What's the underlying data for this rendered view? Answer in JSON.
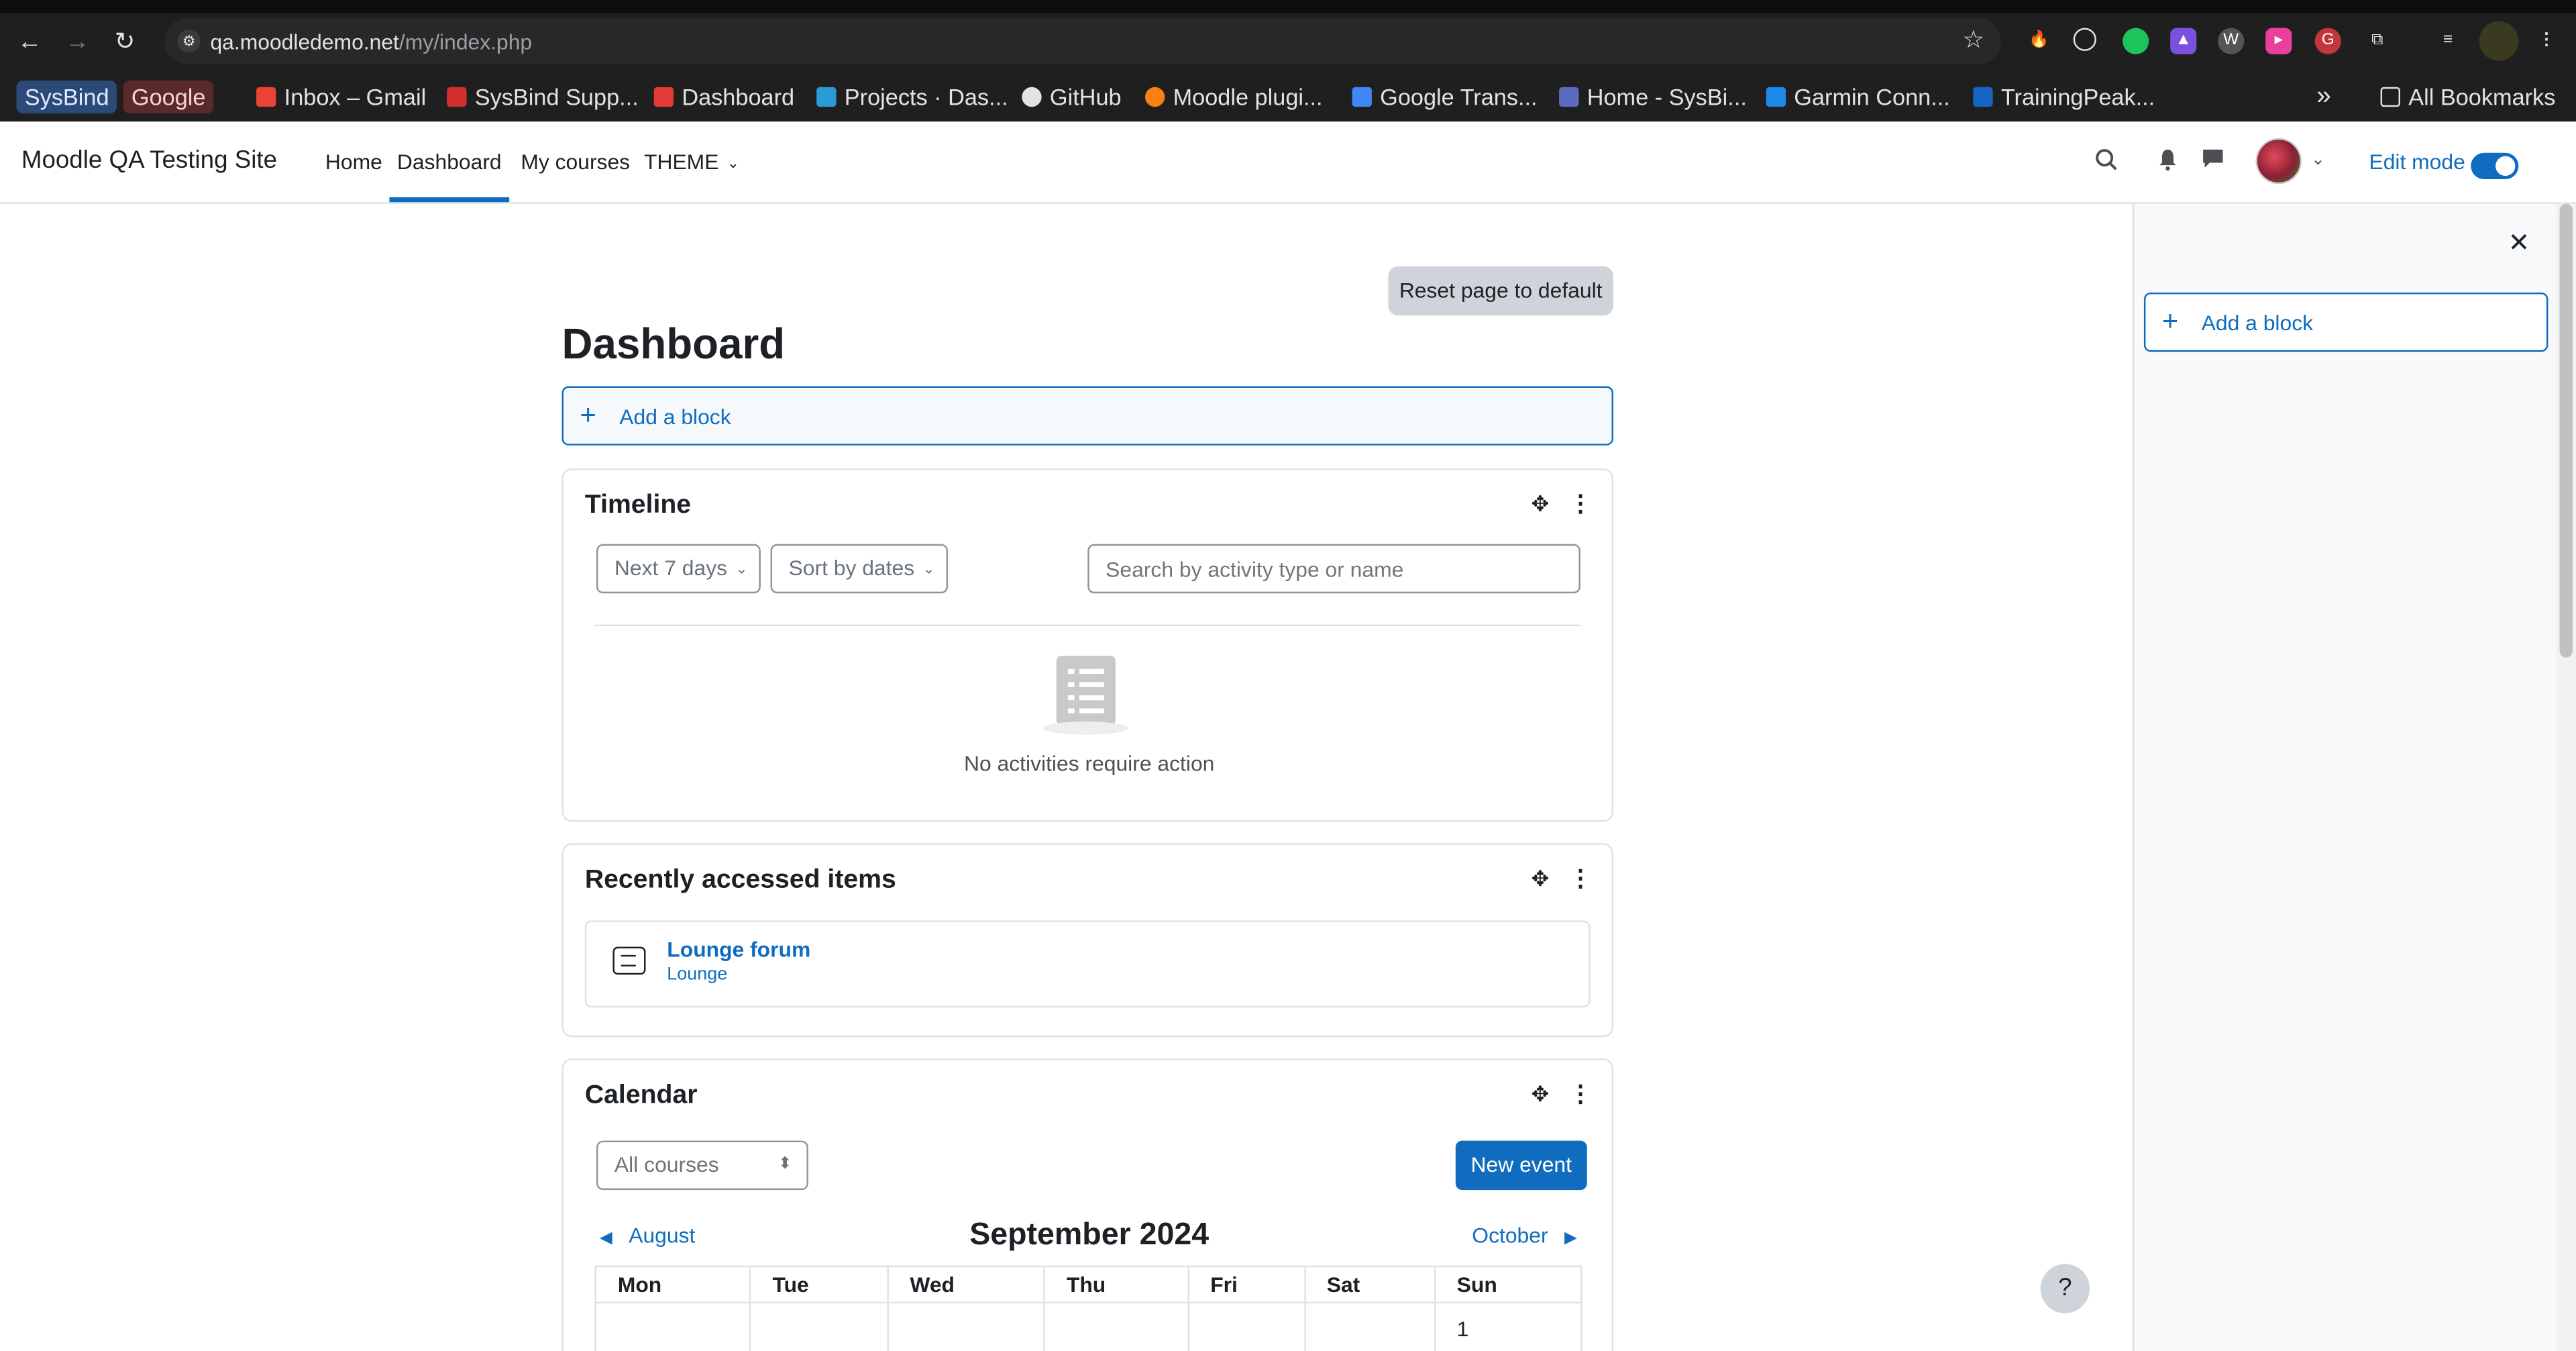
{
  "browser": {
    "url_host": "qa.moodledemo.net",
    "url_path": "/my/index.php",
    "bookmarks": [
      "SysBind",
      "Google",
      "Inbox – Gmail",
      "SysBind Supp...",
      "Dashboard",
      "Projects · Das...",
      "GitHub",
      "Moodle plugi...",
      "Google Trans...",
      "Home - SysBi...",
      "Garmin Conn...",
      "TrainingPeak..."
    ],
    "more_bookmarks": "»",
    "all_bookmarks": "All Bookmarks"
  },
  "navbar": {
    "site_name": "Moodle QA Testing Site",
    "links": [
      "Home",
      "Dashboard",
      "My courses",
      "THEME"
    ],
    "active": "Dashboard",
    "edit_mode_label": "Edit mode",
    "edit_mode_on": true
  },
  "drawer": {
    "close": "✕",
    "add_block": "Add a block"
  },
  "main": {
    "reset_button": "Reset page to default",
    "title": "Dashboard",
    "add_block": "Add a block"
  },
  "timeline": {
    "title": "Timeline",
    "range_select": "Next 7 days",
    "sort_select": "Sort by dates",
    "search_placeholder": "Search by activity type or name",
    "empty_text": "No activities require action"
  },
  "recent": {
    "title": "Recently accessed items",
    "items": [
      {
        "name": "Lounge forum",
        "course": "Lounge"
      }
    ]
  },
  "calendar": {
    "title": "Calendar",
    "course_select": "All courses",
    "new_event": "New event",
    "prev_month": "August",
    "current_month": "September 2024",
    "next_month": "October",
    "weekdays": [
      "Mon",
      "Tue",
      "Wed",
      "Thu",
      "Fri",
      "Sat",
      "Sun"
    ],
    "first_row": [
      "",
      "",
      "",
      "",
      "",
      "",
      "1"
    ]
  },
  "help_button": "?",
  "colors": {
    "primary": "#0f6cbf",
    "chrome_bg": "#1f1f1f",
    "drawer_bg": "#f8f9fa"
  }
}
